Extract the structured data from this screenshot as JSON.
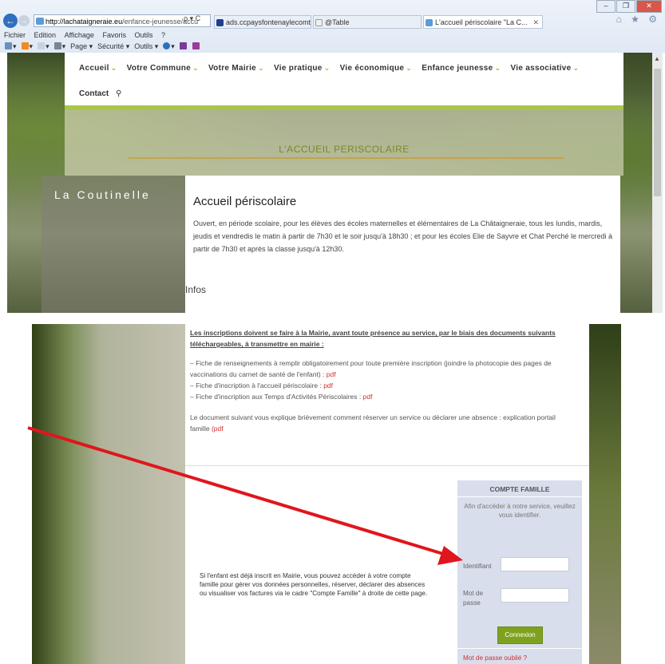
{
  "browser": {
    "url_domain": "http://lachataigneraie.eu",
    "url_path": "/enfance-jeunesse/accu",
    "url_actions": "ρ ▾ C",
    "tabs": [
      {
        "label": "ads.ccpaysfontenaylecomte.fr",
        "color": "#1f3f8f"
      },
      {
        "label": "@Table",
        "color": "#f0f0f0"
      },
      {
        "label": "L'accueil périscolaire \"La C...",
        "color": "#5a9bd8"
      }
    ],
    "tab_close": "✕",
    "menu": [
      "Fichier",
      "Edition",
      "Affichage",
      "Favoris",
      "Outils",
      "?"
    ],
    "commands": [
      "Page ▾",
      "Sécurité ▾",
      "Outils ▾"
    ],
    "window_controls": [
      "–",
      "❐",
      "✕"
    ],
    "home_icons": "⌂ ★ ⚙"
  },
  "nav": {
    "items": [
      "Accueil",
      "Votre Commune",
      "Votre Mairie",
      "Vie pratique",
      "Vie économique",
      "Enfance jeunesse",
      "Vie associative"
    ],
    "chevron": "⌄",
    "contact": "Contact",
    "search_icon": "🔍"
  },
  "banner": {
    "title": "L'ACCUEIL PERISCOLAIRE"
  },
  "sidebar": {
    "title": "La Coutinelle"
  },
  "main": {
    "heading": "Accueil périscolaire",
    "paragraph": "Ouvert, en période scolaire, pour les élèves des écoles maternelles et élémentaires de La Châtaigneraie, tous les lundis, mardis, jeudis et vendredis le matin à partir de 7h30 et le soir jusqu'à 18h30 ; et pour les écoles Elie de Sayvre et Chat Perché le mercredi à partir de 7h30 et après la classe jusqu'à 12h30.",
    "infos": "Infos"
  },
  "inscriptions": {
    "intro": "Les inscriptions doivent se faire à la Mairie, avant toute présence au service, par le biais des documents suivants téléchargeables, à transmettre en mairie :",
    "items": [
      {
        "text": "– Fiche de renseignements à remplir obligatoirement pour toute première inscription (joindre la photocopie des pages de vaccinations du carnet de santé de l'enfant) : ",
        "link": "pdf"
      },
      {
        "text": "– Fiche d'inscription à l'accueil périscolaire : ",
        "link": "pdf"
      },
      {
        "text": "– Fiche d'inscription aux Temps d'Activités Périscolaires : ",
        "link": "pdf"
      }
    ],
    "doc_text": "Le document suivant vous explique brièvement comment réserver un service ou déclarer une absence : explication portail famille ",
    "doc_link": "(pdf"
  },
  "family": {
    "text": "Si l'enfant est déjà inscrit en Mairie, vous pouvez accéder à votre compte famille pour gérer vos données personnelles, réserver, déclarer des absences ou visualiser vos factures via le cadre \"Compte Famille\" à droite de cette page."
  },
  "account": {
    "title": "COMPTE FAMILLE",
    "intro": "Afin d'accéder à notre service, veuillez vous identifier.",
    "id_label": "Identifiant",
    "id_value": "",
    "pwd_label": "Mot de passe",
    "pwd_value": "",
    "submit": "Connexion",
    "forgot": "Mot de passe oublié ?"
  },
  "colors": {
    "accent_green": "#a8c64a",
    "button_green": "#7fa21e",
    "link_red": "#d03030",
    "annotation_arrow": "#e0161c"
  }
}
